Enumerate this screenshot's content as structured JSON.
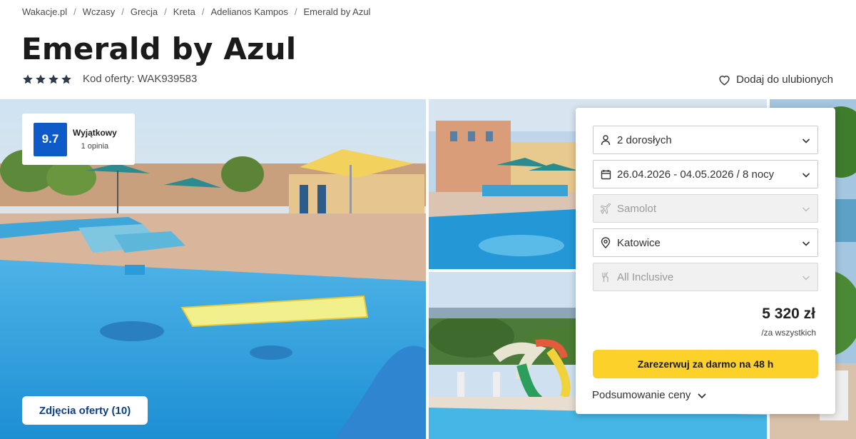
{
  "breadcrumb": [
    "Wakacje.pl",
    "Wczasy",
    "Grecja",
    "Kreta",
    "Adelianos Kampos",
    "Emerald by Azul"
  ],
  "breadcrumb_separator": "/",
  "title": "Emerald by Azul",
  "stars": 4,
  "offer_code": "Kod oferty: WAK939583",
  "favourite_label": "Dodaj do ulubionych",
  "rating": {
    "score": "9.7",
    "label": "Wyjątkowy",
    "count": "1 opinia"
  },
  "photos_button": "Zdjęcia oferty (10)",
  "booking": {
    "travelers": "2 dorosłych",
    "dates": "26.04.2026 - 04.05.2026 / 8 nocy",
    "transport": "Samolot",
    "departure": "Katowice",
    "board": "All Inclusive",
    "price": "5 320 zł",
    "price_note": "/za wszystkich",
    "book_button": "Zarezerwuj za darmo na 48 h",
    "summary": "Podsumowanie ceny"
  },
  "colors": {
    "accent": "#0d5ac8",
    "cta": "#fcd12a",
    "link": "#0d3f8c"
  }
}
